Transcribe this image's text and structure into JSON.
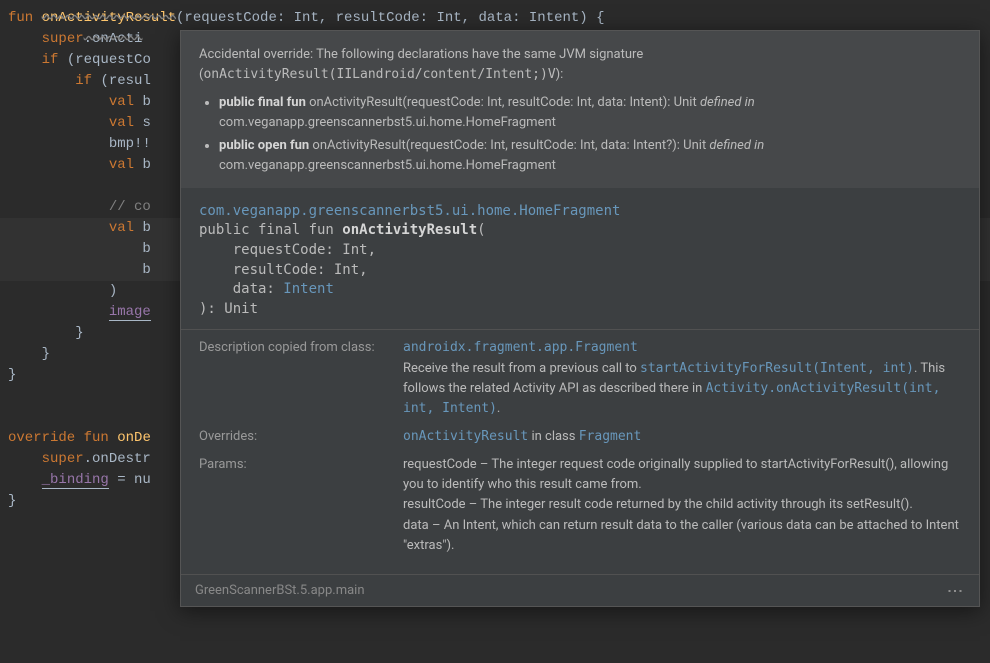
{
  "code": {
    "l1_fun": "fun ",
    "l1_name": "onActivityResult",
    "l1_params": "(requestCode: Int, resultCode: Int, data: Intent) {",
    "l2_super": "super",
    "l2_call": ".onActi",
    "l3_if": "if ",
    "l3_cond": "(requestCo",
    "l4_if": "if ",
    "l4_cond": "(resul",
    "l5_val": "val ",
    "l5_rest": "b",
    "l6_val": "val ",
    "l6_rest": "s",
    "l7": "bmp!!",
    "l8_val": "val ",
    "l8_rest": "b",
    "l10": "// co",
    "l11_val": "val ",
    "l11_rest": "b",
    "l12": "b",
    "l13": "b",
    "l14": ")",
    "l15": "image",
    "l16": "}",
    "l17": "}",
    "l18": "}",
    "l20_override": "override ",
    "l20_fun": "fun ",
    "l20_name": "onDe",
    "l21_super": "super",
    "l21_rest": ".onDestr",
    "l22_bind": "_binding",
    "l22_rest": " = nu",
    "l23": "}"
  },
  "tooltip": {
    "header": {
      "text1": "Accidental override: The following declarations have the same JVM signature (",
      "sig": "onActivityResult(IILandroid/content/Intent;)V",
      "text2": "):",
      "bullet1_prefix": "public final fun",
      "bullet1_sig": " onActivityResult(requestCode: Int, resultCode: Int, data: Intent): Unit ",
      "bullet1_def": "defined in",
      "bullet1_loc": " com.veganapp.greenscannerbst5.ui.home.HomeFragment",
      "bullet2_prefix": "public open fun",
      "bullet2_sig": " onActivityResult(requestCode: Int, resultCode: Int, data: Intent?): Unit ",
      "bullet2_def": "defined in",
      "bullet2_loc": " com.veganapp.greenscannerbst5.ui.home.HomeFragment"
    },
    "signature": {
      "pkg": "com.veganapp.greenscannerbst5.ui.home.HomeFragment",
      "line1": "public final fun ",
      "fname": "onActivityResult",
      "paren": "(",
      "p1": "    requestCode: Int,",
      "p2": "    resultCode: Int,",
      "p3a": "    data: ",
      "p3b": "Intent",
      "close": "): Unit"
    },
    "desc": {
      "label1": "Description copied from class:",
      "fragment": "androidx.fragment.app.Fragment",
      "text1": "Receive the result from a previous call to ",
      "link1": "startActivityForResult(Intent, int)",
      "text2": ". This follows the related Activity API as described there in ",
      "link2": "Activity.onActivityResult(int, int, Intent)",
      "text3": ".",
      "label2": "Overrides:",
      "ov1": "onActivityResult",
      "ov2": " in class ",
      "ov3": "Fragment",
      "label3": "Params:",
      "param1": "requestCode – The integer request code originally supplied to startActivityForResult(), allowing you to identify who this result came from.",
      "param2": "resultCode – The integer result code returned by the child activity through its setResult().",
      "param3": "data – An Intent, which can return result data to the caller (various data can be attached to Intent \"extras\")."
    },
    "footer": "GreenScannerBSt.5.app.main"
  }
}
